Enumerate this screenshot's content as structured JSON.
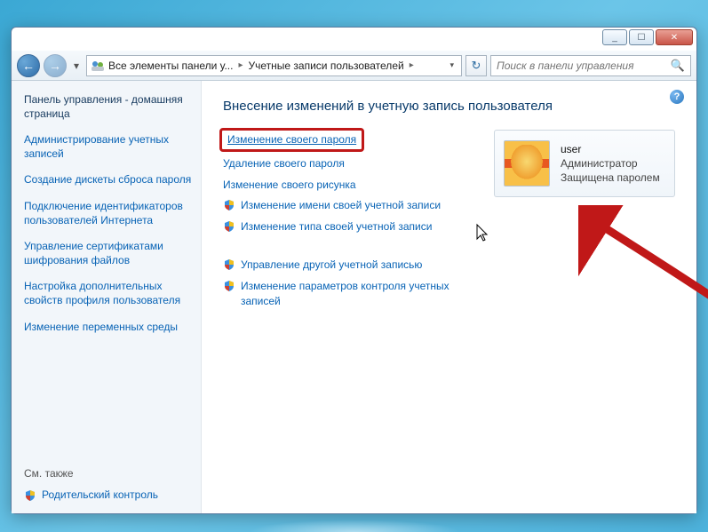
{
  "window_controls": {
    "min": "_",
    "max": "☐",
    "close": "✕"
  },
  "nav": {
    "back_glyph": "←",
    "fwd_glyph": "→",
    "dropdown_glyph": "▾",
    "refresh_glyph": "↻"
  },
  "breadcrumb": {
    "seg1": "Все элементы панели у...",
    "seg2": "Учетные записи пользователей",
    "sep": "▸",
    "drop": "▾"
  },
  "search": {
    "placeholder": "Поиск в панели управления",
    "icon": "🔍"
  },
  "sidebar": {
    "heading": "Панель управления - домашняя страница",
    "items": [
      "Администрирование учетных записей",
      "Создание дискеты сброса пароля",
      "Подключение идентификаторов пользователей Интернета",
      "Управление сертификатами шифрования файлов",
      "Настройка дополнительных свойств профиля пользователя",
      "Изменение переменных среды"
    ],
    "see_also": "См. также",
    "parental": "Родительский контроль"
  },
  "main": {
    "help_glyph": "?",
    "title": "Внесение изменений в учетную запись пользователя",
    "links": [
      {
        "label": "Изменение своего пароля",
        "shield": false,
        "highlight": true
      },
      {
        "label": "Удаление своего пароля",
        "shield": false,
        "highlight": false
      },
      {
        "label": "Изменение своего рисунка",
        "shield": false,
        "highlight": false
      },
      {
        "label": "Изменение имени своей учетной записи",
        "shield": true,
        "highlight": false
      },
      {
        "label": "Изменение типа своей учетной записи",
        "shield": true,
        "highlight": false
      }
    ],
    "links2": [
      {
        "label": "Управление другой учетной записью",
        "shield": true
      },
      {
        "label": "Изменение параметров контроля учетных записей",
        "shield": true
      }
    ]
  },
  "user": {
    "name": "user",
    "role": "Администратор",
    "protected": "Защищена паролем"
  }
}
